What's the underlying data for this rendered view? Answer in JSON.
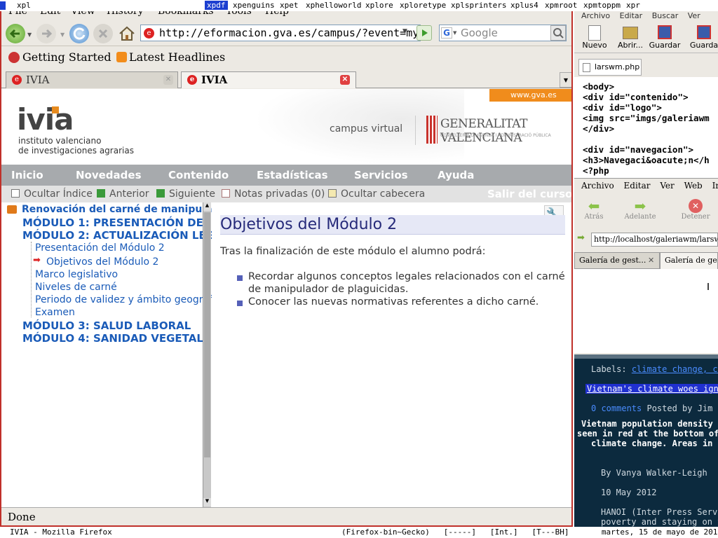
{
  "wmbar": {
    "items": [
      "xpl",
      "xpdf",
      "xpenguins",
      "xpet",
      "xphelloworld",
      "xplore",
      "xploretype",
      "xplsprinters",
      "xplus4",
      "xpmroot",
      "xpmtoppm",
      "xpr"
    ]
  },
  "firefox": {
    "menu": [
      "File",
      "Edit",
      "View",
      "History",
      "Bookmarks",
      "Tools",
      "Help"
    ],
    "url": "http://eformacion.gva.es/campus/?event=my",
    "search_placeholder": "Google",
    "bookmarks": [
      "Getting Started",
      "Latest Headlines"
    ],
    "tabs": [
      {
        "label": "IVIA",
        "active": false
      },
      {
        "label": "IVIA",
        "active": true
      }
    ],
    "status": "Done"
  },
  "site": {
    "gva_tag": "www.gva.es",
    "logo_text": "ivia",
    "logo_sub1": "instituto valenciano",
    "logo_sub2": "de investigaciones agrarias",
    "campus": "campus virtual",
    "generalitat": "GENERALITAT VALENCIANA",
    "conselleria": "CONSELLERIA D'HISENDA I ADMINISTRACIÓ PÚBLICA",
    "nav": [
      "Inicio",
      "Novedades",
      "Contenido",
      "Estadísticas",
      "Servicios",
      "Ayuda"
    ],
    "subnav": {
      "hide_index": "Ocultar Índice",
      "prev": "Anterior",
      "next": "Siguiente",
      "notes": "Notas privadas (0)",
      "hide_header": "Ocultar cabecera",
      "exit": "Salir del curso"
    },
    "tree": {
      "root": "Renovación del carné de manipulado",
      "modules": [
        "MÓDULO 1: PRESENTACIÓN DEL CU",
        "MÓDULO 2: ACTUALIZACIÓN LEGISL"
      ],
      "subitems": [
        "Presentación del Módulo 2",
        "Objetivos del Módulo 2",
        "Marco legislativo",
        "Niveles de carné",
        "Periodo de validez y ámbito geográfico",
        "Examen"
      ],
      "modules_after": [
        "MÓDULO 3: SALUD LABORAL",
        "MÓDULO 4: SANIDAD VEGETAL"
      ]
    },
    "main": {
      "title": "Objetivos del Módulo 2",
      "intro": "Tras la finalización de este módulo el alumno podrá:",
      "bullets": [
        "Recordar algunos conceptos legales relacionados con el carné de manipulador de plaguicidas.",
        "Conocer las nuevas normativas referentes a dicho carné."
      ]
    }
  },
  "editor": {
    "menu": [
      "Archivo",
      "Editar",
      "Buscar",
      "Ver"
    ],
    "buttons": [
      "Nuevo",
      "Abrir...",
      "Guardar",
      "Guarda"
    ],
    "file_tab": "larswm.php",
    "code": "<body>\n<div id=\"contenido\">\n<div id=\"logo\">\n<img src=\"imgs/galeriawm\n</div>\n\n<div id=\"navegacion\">\n<h3>Navegaci&oacute;n</h\n<?php"
  },
  "browser2": {
    "menu": [
      "Archivo",
      "Editar",
      "Ver",
      "Web",
      "Ir"
    ],
    "buttons": [
      "Atrás",
      "Adelante",
      "Detener"
    ],
    "url": "http://localhost/galeriawm/larswm.",
    "tabs": [
      "Galería de gest...",
      "Galería de ges"
    ]
  },
  "blog": {
    "labels_prefix": "Labels:",
    "labels": "climate change, co",
    "headline": "Vietnam's climate woes igni",
    "comments": "0 comments",
    "posted": "Posted by Jim a",
    "body1": "Vietnam population density w",
    "body2": "seen in red at the bottom of",
    "body3": "climate change. Areas in r",
    "author": "By Vanya Walker-Leigh",
    "date": "10 May 2012",
    "dateline": "HANOI (Inter Press Servi",
    "tail": "poverty and staying on t"
  },
  "taskbar": {
    "left": "IVIA - Mozilla Firefox",
    "right": "(Firefox-bin~Gecko)   [-----]   [Int.]   [T---BH]       martes, 15 de mayo de 2012 -- 16:10"
  }
}
